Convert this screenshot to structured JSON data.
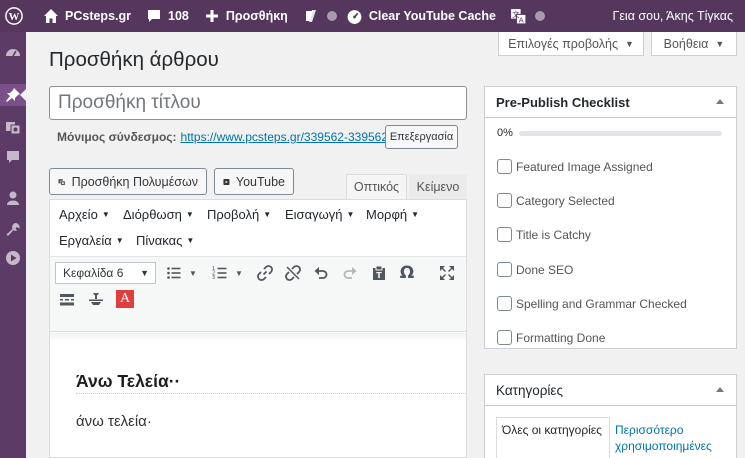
{
  "adminbar": {
    "site_name": "PCsteps.gr",
    "comments_count": "108",
    "new_label": "Προσθήκη",
    "clear_cache_label": "Clear YouTube Cache",
    "greeting": "Γεια σου, Άκης Τίγκας"
  },
  "screen_options": {
    "screen_label": "Επιλογές προβολής",
    "help_label": "Βοήθεια"
  },
  "page": {
    "title": "Προσθήκη άρθρου",
    "title_placeholder": "Προσθήκη τίτλου",
    "permalink_label": "Μόνιμος σύνδεσμος:",
    "permalink_url": "https://www.pcsteps.gr/339562-339562/",
    "edit_label": "Επεξεργασία"
  },
  "media": {
    "add_media": "Προσθήκη Πολυμέσων",
    "youtube": "YouTube"
  },
  "editor": {
    "tab_visual": "Οπτικός",
    "tab_text": "Κείμενο",
    "menus": [
      "Αρχείο",
      "Διόρθωση",
      "Προβολή",
      "Εισαγωγή",
      "Μορφή",
      "Εργαλεία",
      "Πίνακας"
    ],
    "format_value": "Κεφαλίδα 6",
    "content_heading": "Άνω Τελεία··",
    "content_paragraph": "άνω τελεία·"
  },
  "checklist": {
    "title": "Pre-Publish Checklist",
    "progress_text": "0%",
    "progress": 0,
    "items": [
      "Featured Image Assigned",
      "Category Selected",
      "Title is Catchy",
      "Done SEO",
      "Spelling and Grammar Checked",
      "Formatting Done"
    ]
  },
  "categories": {
    "title": "Κατηγορίες",
    "tab_all": "Όλες οι κατηγορίες",
    "tab_popular": "Περισσότερο χρησιμοποιημένες"
  },
  "colors": {
    "adminbar": "#55375e",
    "adminmenu": "#5c3c66",
    "link": "#0073aa",
    "progress": "#0085ba"
  }
}
